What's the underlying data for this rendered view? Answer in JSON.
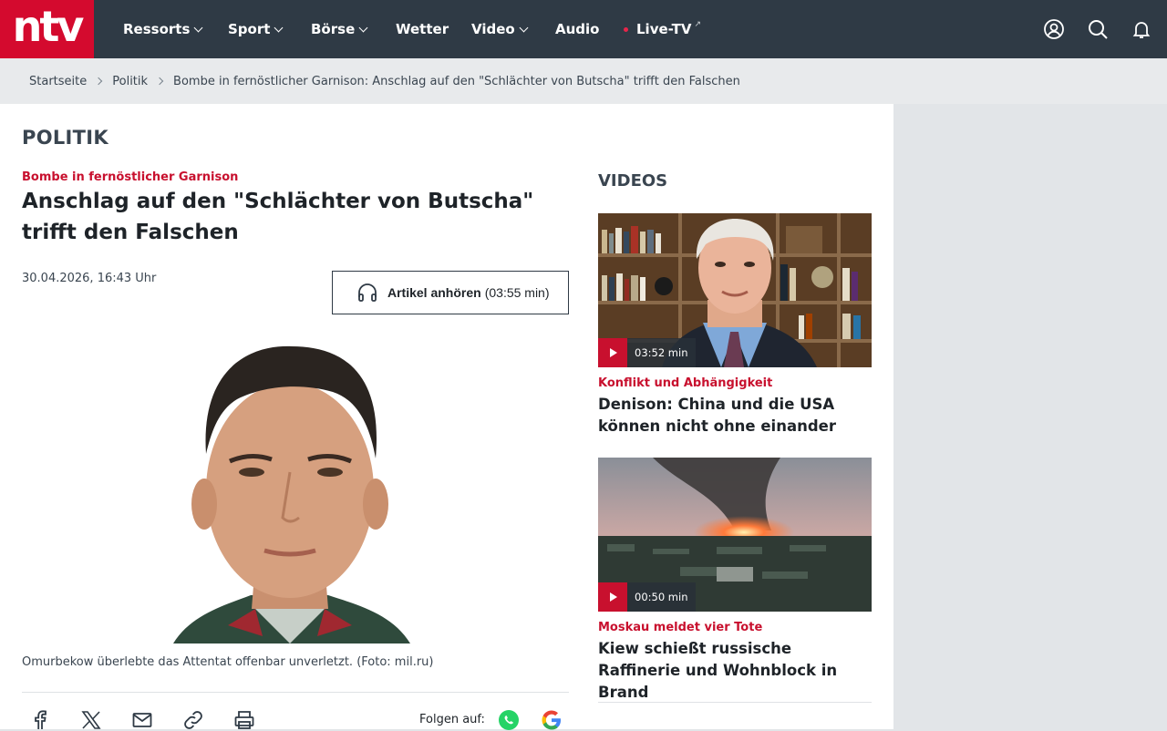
{
  "nav": {
    "logo": "ntv",
    "items": [
      {
        "label": "Ressorts",
        "dropdown": true
      },
      {
        "label": "Sport",
        "dropdown": true
      },
      {
        "label": "Börse",
        "dropdown": true
      },
      {
        "label": "Wetter",
        "dropdown": false
      },
      {
        "label": "Video",
        "dropdown": true
      },
      {
        "label": "Audio",
        "dropdown": false
      },
      {
        "label": "Live-TV",
        "dropdown": false,
        "external": "↗"
      }
    ],
    "icons": [
      "user-icon",
      "search-icon",
      "bell-icon"
    ]
  },
  "breadcrumb": {
    "items": [
      "Startseite",
      "Politik",
      "Bombe in fernöstlicher Garnison: Anschlag auf den \"Schlächter von Butscha\" trifft den Falschen"
    ]
  },
  "section": {
    "title": "POLITIK"
  },
  "article": {
    "kicker": "Bombe in fernöstlicher Garnison",
    "headline": "Anschlag auf den \"Schlächter von Butscha\" trifft den Falschen",
    "date": "30.04.2026, 16:43 Uhr",
    "listen": {
      "label": "Artikel anhören",
      "duration": "(03:55 min)"
    },
    "caption": "Omurbekow überlebte das Attentat offenbar unverletzt. (Foto: mil.ru)"
  },
  "share": {
    "icons": [
      "facebook-icon",
      "x-icon",
      "mail-icon",
      "link-icon",
      "print-icon"
    ],
    "follow_label": "Folgen auf:",
    "follow_icons": [
      "whatsapp-icon",
      "google-icon"
    ]
  },
  "videos": {
    "title": "VIDEOS",
    "items": [
      {
        "duration": "03:52 min",
        "kicker": "Konflikt und Abhängigkeit",
        "title": "Denison: China und die USA können nicht ohne einander"
      },
      {
        "duration": "00:50 min",
        "kicker": "Moskau meldet vier Tote",
        "title": "Kiew schießt russische Raffinerie und Wohnblock in Brand"
      }
    ]
  },
  "colors": {
    "brand": "#d40a2e",
    "nav_bg": "#2f3a45",
    "kicker": "#c8102e"
  }
}
